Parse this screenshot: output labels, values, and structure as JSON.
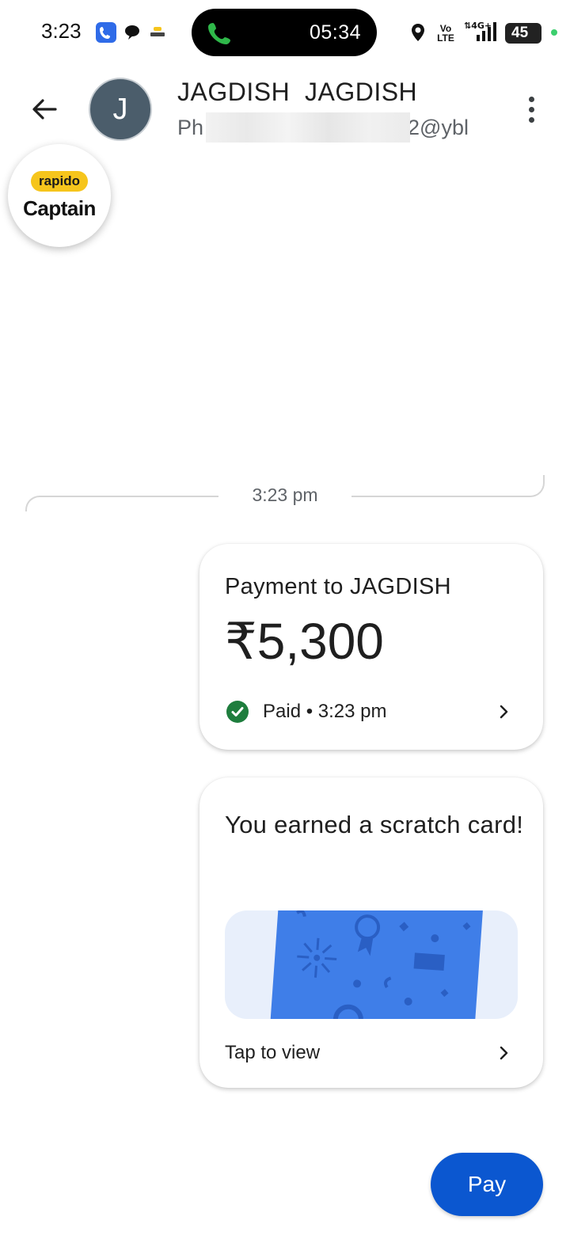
{
  "status_bar": {
    "time": "3:23",
    "call_timer": "05:34",
    "network_label": "Vo\nLTE",
    "battery": "45",
    "icons": [
      "phone-app-icon",
      "chat-app-icon",
      "captain-app-icon",
      "call-icon",
      "location-icon",
      "signal-icon",
      "battery-icon"
    ]
  },
  "header": {
    "avatar_initial": "J",
    "contact_name": "JAGDISH  JAGDISH",
    "upi_prefix": "Ph",
    "upi_suffix": "2@ybl"
  },
  "overlay": {
    "brand_pill": "rapido",
    "brand_name": "Captain"
  },
  "chat": {
    "divider_time": "3:23 pm",
    "payment_card": {
      "title": "Payment to JAGDISH",
      "amount": "₹5,300",
      "status": "Paid • 3:23 pm",
      "status_color": "#1e7d3d"
    },
    "scratch_card": {
      "title": "You earned a scratch card!",
      "cta": "Tap to view",
      "art_color": "#3f7ee8"
    }
  },
  "actions": {
    "pay_label": "Pay",
    "pay_color": "#0b57d0"
  }
}
